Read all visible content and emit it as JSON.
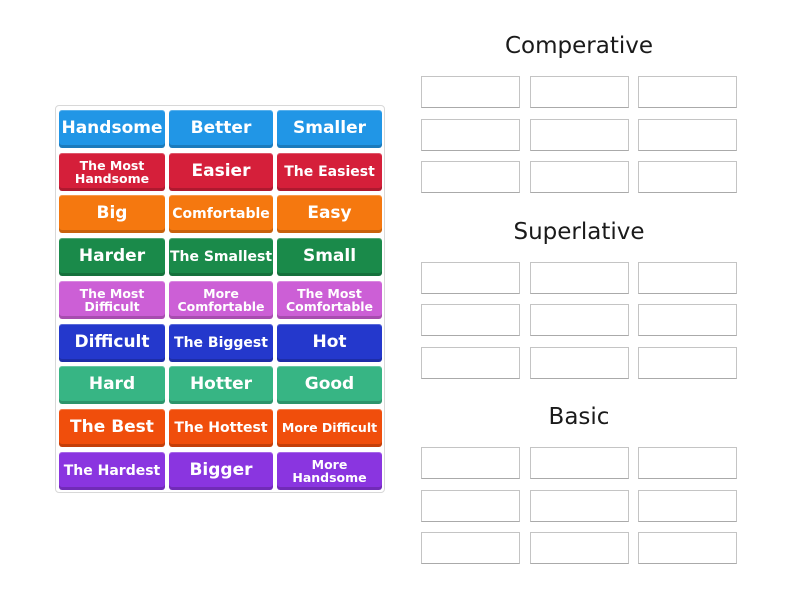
{
  "activity": "group sort",
  "tiles": [
    {
      "label": "Handsome",
      "color": "#2196e6"
    },
    {
      "label": "Better",
      "color": "#2196e6"
    },
    {
      "label": "Smaller",
      "color": "#2196e6"
    },
    {
      "label": "The Most Handsome",
      "color": "#d51f3a"
    },
    {
      "label": "Easier",
      "color": "#d51f3a"
    },
    {
      "label": "The Easiest",
      "color": "#d51f3a"
    },
    {
      "label": "Big",
      "color": "#f5780f"
    },
    {
      "label": "Comfortable",
      "color": "#f5780f"
    },
    {
      "label": "Easy",
      "color": "#f5780f"
    },
    {
      "label": "Harder",
      "color": "#1a8a4a"
    },
    {
      "label": "The Smallest",
      "color": "#1a8a4a"
    },
    {
      "label": "Small",
      "color": "#1a8a4a"
    },
    {
      "label": "The Most Difficult",
      "color": "#cc5fd6"
    },
    {
      "label": "More Comfortable",
      "color": "#cc5fd6"
    },
    {
      "label": "The Most Comfortable",
      "color": "#cc5fd6"
    },
    {
      "label": "Difficult",
      "color": "#2438cc"
    },
    {
      "label": "The Biggest",
      "color": "#2438cc"
    },
    {
      "label": "Hot",
      "color": "#2438cc"
    },
    {
      "label": "Hard",
      "color": "#37b584"
    },
    {
      "label": "Hotter",
      "color": "#37b584"
    },
    {
      "label": "Good",
      "color": "#37b584"
    },
    {
      "label": "The Best",
      "color": "#f04e0c"
    },
    {
      "label": "The Hottest",
      "color": "#f04e0c"
    },
    {
      "label": "More Difficult",
      "color": "#f04e0c"
    },
    {
      "label": "The Hardest",
      "color": "#8a35e0"
    },
    {
      "label": "Bigger",
      "color": "#8a35e0"
    },
    {
      "label": "More Handsome",
      "color": "#8a35e0"
    }
  ],
  "groups": [
    {
      "title": "Comperative",
      "slot_count": 9
    },
    {
      "title": "Superlative",
      "slot_count": 9
    },
    {
      "title": "Basic",
      "slot_count": 9
    }
  ]
}
